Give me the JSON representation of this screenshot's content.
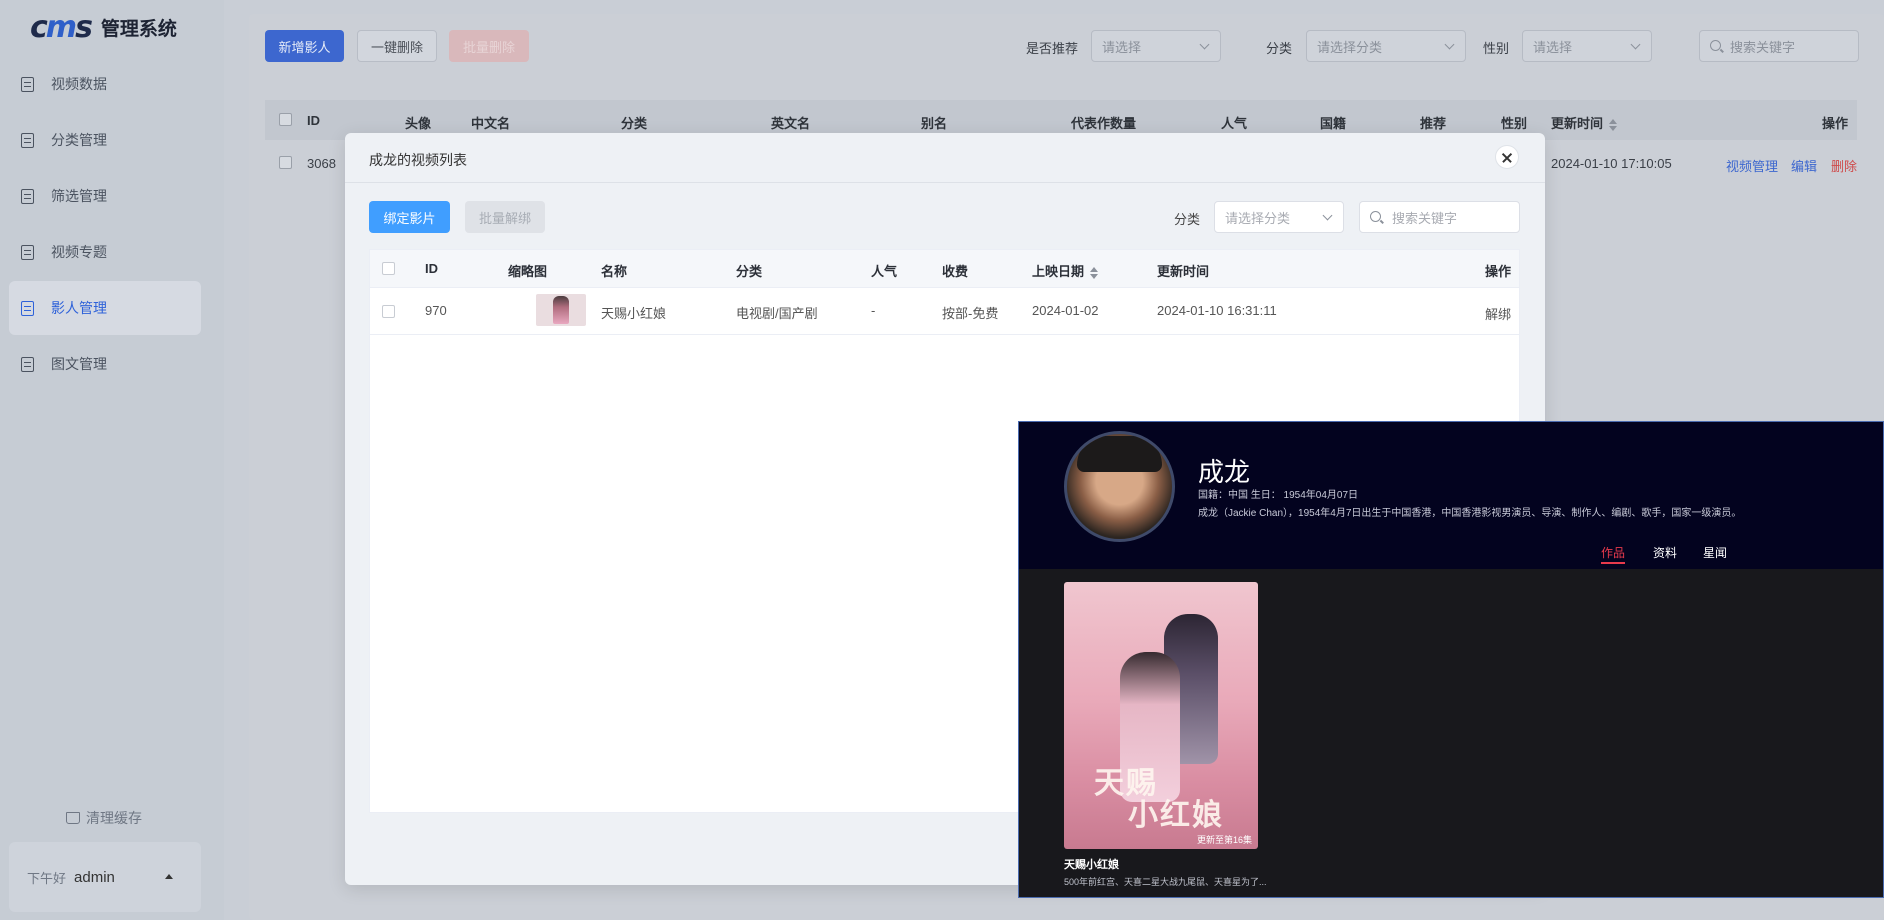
{
  "sidebar": {
    "logo_text": "管理系统",
    "items": [
      {
        "label": "视频数据"
      },
      {
        "label": "分类管理"
      },
      {
        "label": "筛选管理"
      },
      {
        "label": "视频专题"
      },
      {
        "label": "影人管理"
      },
      {
        "label": "图文管理"
      }
    ],
    "active_index": 4,
    "clear_cache": "清理缓存",
    "greeting": "下午好",
    "username": "admin"
  },
  "toolbar": {
    "add_label": "新增影人",
    "delete_all_label": "一键删除",
    "batch_delete_label": "批量删除",
    "filter_recommend_label": "是否推荐",
    "filter_recommend_placeholder": "请选择",
    "filter_category_label": "分类",
    "filter_category_placeholder": "请选择分类",
    "filter_gender_label": "性别",
    "filter_gender_placeholder": "请选择",
    "search_placeholder": "搜索关键字"
  },
  "table": {
    "columns": [
      "ID",
      "头像",
      "中文名",
      "分类",
      "英文名",
      "别名",
      "代表作数量",
      "人气",
      "国籍",
      "推荐",
      "性别",
      "更新时间",
      "操作"
    ],
    "rows": [
      {
        "id": "3068",
        "updated": "2024-01-10 17:10:05",
        "action_videos": "视频管理",
        "action_edit": "编辑",
        "action_delete": "删除"
      }
    ]
  },
  "modal": {
    "title": "成龙的视频列表",
    "bind_label": "绑定影片",
    "batch_unbind_label": "批量解绑",
    "category_label": "分类",
    "category_placeholder": "请选择分类",
    "search_placeholder": "搜索关键字",
    "columns": [
      "ID",
      "缩略图",
      "名称",
      "分类",
      "人气",
      "收费",
      "上映日期",
      "更新时间",
      "操作"
    ],
    "rows": [
      {
        "id": "970",
        "name": "天赐小红娘",
        "category": "电视剧/国产剧",
        "popularity": "-",
        "fee": "按部-免费",
        "release": "2024-01-02",
        "updated": "2024-01-10 16:31:11",
        "action": "解绑"
      }
    ]
  },
  "preview": {
    "name": "成龙",
    "meta": "国籍：中国   生日：  1954年04月07日",
    "desc": "成龙（Jackie Chan），1954年4月7日出生于中国香港，中国香港影视男演员、导演、制作人、编剧、歌手，国家一级演员。",
    "tabs": [
      "作品",
      "资料",
      "星闻"
    ],
    "active_tab": 0,
    "work": {
      "title": "天赐小红娘",
      "subtitle": "500年前红宫、天喜二星大战九尾鼠、天喜星为了...",
      "badge": "更新至第16集",
      "poster_text_line1": "天赐",
      "poster_text_line2": "小红娘"
    }
  },
  "colors": {
    "primary": "#3d67cf",
    "modal_primary": "#409eff",
    "danger": "#e83a4c",
    "preview_bg": "#03031f"
  }
}
